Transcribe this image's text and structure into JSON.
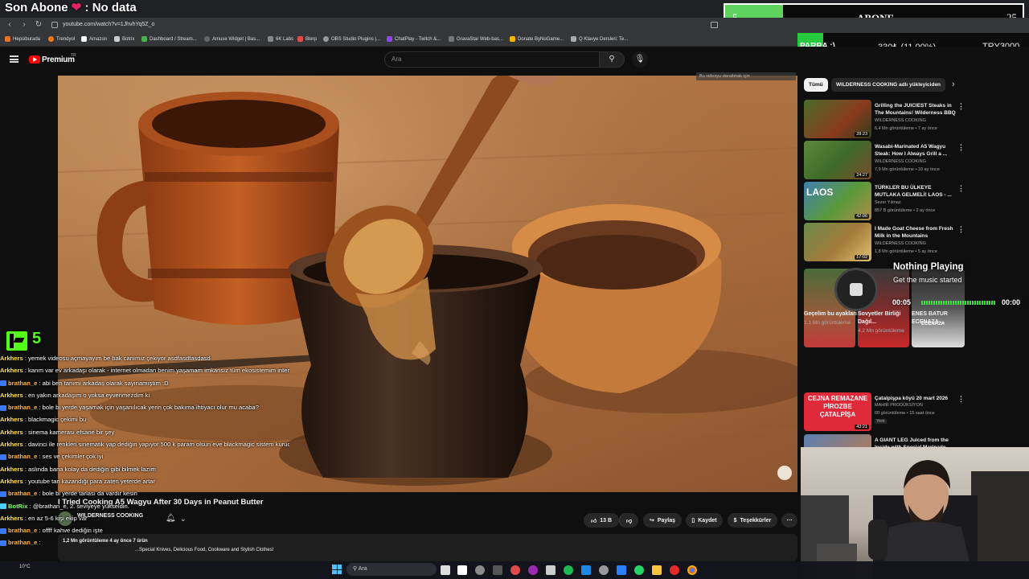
{
  "overlay": {
    "last_sub_prefix": "Son Abone",
    "heart": "❤",
    "last_sub_suffix": ": No data",
    "goal_current": "5",
    "goal_label": "ABONE",
    "goal_target": "25",
    "donation_label": "PARRA :)",
    "donation_progress": "330₺ (11.00%)",
    "donation_target": "TRY3000",
    "kick_count": "5"
  },
  "browser": {
    "url": "youtube.com/watch?v=1JhvhYq5Z_o",
    "bookmarks": [
      "Hepsiburada",
      "Trendyol",
      "Amazon",
      "Botrix",
      "Dashboard / Stream...",
      "Amuse Widget | Bas...",
      "6K Labs",
      "Blerp",
      "OBS Studio Plugins |...",
      "ChatPlay - Twitch &...",
      "GravaStar Web-bas...",
      "Donate ByNoGame...",
      "Q Klavye Dersleri: Te..."
    ]
  },
  "youtube": {
    "brand": "Premium",
    "brand_sup": "TR",
    "search_placeholder": "Ara",
    "download_hint": "Bu videoyu daraltmak için",
    "video_title": "I Tried Cooking A5 Wagyu After 30 Days in Peanut Butter",
    "channel": "WILDERNESS COOKING",
    "meta_line": "1,2 Mn görüntüleme  4 ay önce  7 ürün",
    "desc_line": "...Special Knives, Delicious Food, Cookware and Stylish Clothes!",
    "like_count": "13 B",
    "share": "Paylaş",
    "save": "Kaydet",
    "thanks": "Teşekkürler",
    "chips": [
      "Tümü",
      "WILDERNESS COOKING adlı yükleyiciden"
    ]
  },
  "recs": [
    {
      "title": "Grilling the JUICIEST Steaks in The Mountains! Wilderness BBQ",
      "channel": "WILDERNESS COOKING",
      "meta": "6,4 Mn görüntüleme • 7 ay önce",
      "duration": "28:23"
    },
    {
      "title": "Wasabi-Marinated A5 Wagyu Steak: How I Always Grill a ...",
      "channel": "WILDERNESS COOKING",
      "meta": "7,9 Mn görüntüleme • 10 ay önce",
      "duration": "24:27"
    },
    {
      "title": "TÜRKLER BU ÜLKEYE MUTLAKA GELMELİ! LAOS - ...",
      "channel": "Sezer Yılmaz",
      "meta": "857 B görüntüleme • 2 ay önce",
      "duration": "42:06"
    },
    {
      "title": "I Made Goat Cheese from Fresh Milk in the Mountains",
      "channel": "WILDERNESS COOKING",
      "meta": "1,8 Mn görüntüleme • 5 ay önce",
      "duration": "17:02"
    },
    {
      "title": "Çatalpişpa köyü 20 mart 2026",
      "channel": "MAHIR PRODÜKSİYON",
      "meta": "60 görüntüleme • 15 saat önce",
      "badge": "Yeni",
      "duration": "43:21",
      "thumb_text": "CEJNA REMAZANE PİROZBE ÇATALPİŞA"
    },
    {
      "title": "A GIANT LEG Juiced from the Inside with Special Marinade",
      "channel": "",
      "meta": "",
      "duration": ""
    }
  ],
  "shorts": [
    {
      "title": "Geçelim bu ayakları",
      "views": "1,1 Mn görüntüleme"
    },
    {
      "title": "Sovyetler Birliği Dağıl...",
      "views": "4,2 Mn görüntüleme"
    },
    {
      "title": "ENES BATUR ECENAZA ...",
      "views": "1,1 Mn görüntüleme"
    }
  ],
  "music": {
    "title": "Nothing Playing",
    "subtitle": "Get the music started",
    "time_start": "00:05",
    "time_end": "00:00"
  },
  "chat": [
    {
      "user": "Arkhers",
      "text": "yemek videosu açmayayım be bak canımız çekiyor asdfasdfasdasd",
      "cls": "ark"
    },
    {
      "user": "Arkhers",
      "text": "karım var ev arkadaşı olarak - internet olmadan benim yaşamam imkansız tüm ekosistemim internet üzerine kurulu",
      "cls": "ark"
    },
    {
      "user": "brathan_e",
      "text": "abi ben tanımı arkadaş olarak sayınamıştım :D",
      "cls": "bra"
    },
    {
      "user": "Arkhers",
      "text": "en yakın arkadaşım o yoksa eyvenmezdim ki",
      "cls": "ark"
    },
    {
      "user": "brathan_e",
      "text": "bole bi yerde yaşamak için yaşanılıcak yerin çok bakıma ihtiyacı olur mu acaba?",
      "cls": "bra"
    },
    {
      "user": "Arkhers",
      "text": "blackmagic çekimi bu",
      "cls": "ark"
    },
    {
      "user": "Arkhers",
      "text": "sinema kamerası efsane bir şey",
      "cls": "ark"
    },
    {
      "user": "Arkhers",
      "text": "davinci ile renkleri sinematik yap dediğin yapıyor 500 k param olsun eve blackmagic sistem kurucam yavrı için",
      "cls": "ark"
    },
    {
      "user": "brathan_e",
      "text": "ses ve çekimler çok iyi",
      "cls": "bra"
    },
    {
      "user": "Arkhers",
      "text": "aslında bana kolay da dediğin gibi bilmek lazım",
      "cls": "ark"
    },
    {
      "user": "Arkhers",
      "text": "youtube tan kazandığı para zaten yeterde artar",
      "cls": "ark"
    },
    {
      "user": "brathan_e",
      "text": "bole bi yerde tarlası da vardır kesin",
      "cls": "bra"
    },
    {
      "user": "BotRix",
      "text": "@brathan_e, 2. seviyeye yükseldin.",
      "cls": "bot"
    },
    {
      "user": "Arkhers",
      "text": "en az 5-6 kişi ekip var",
      "cls": "ark"
    },
    {
      "user": "brathan_e",
      "text": "offff kahve dediğin işte",
      "cls": "bra"
    },
    {
      "user": "brathan_e",
      "text": "",
      "cls": "bra"
    }
  ],
  "taskbar": {
    "search": "Ara",
    "weather": "10°C"
  }
}
